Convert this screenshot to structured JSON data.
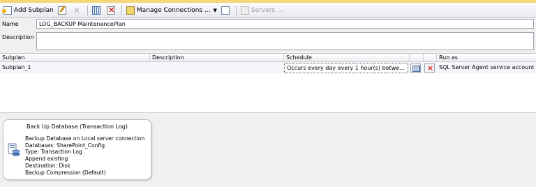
{
  "toolbar": {
    "add_subplan_label": "Add Subplan",
    "manage_connections_label": "Manage Connections ...",
    "servers_label": "Servers ..."
  },
  "form": {
    "name_label": "Name",
    "name_value": "LOG_BACKUP MaintenancePlan",
    "description_label": "Description",
    "description_value": ""
  },
  "grid": {
    "columns": [
      "Subplan",
      "Description",
      "Schedule",
      "Run as"
    ],
    "rows": [
      {
        "subplan": "Subplan_1",
        "description": "",
        "schedule": "Occurs every day every 1 hour(s) betwe...",
        "run_as": "SQL Server Agent service account"
      }
    ]
  },
  "task": {
    "title": "Back Up Database (Transaction Log)",
    "lines": [
      "Backup Database on Local server connection",
      "Databases: SharePoint_Config",
      "Type: Transaction Log",
      "Append existing",
      "Destination: Disk",
      "Backup Compression (Default)"
    ]
  },
  "colors": {
    "top_strip": "#f5d77a",
    "selected_row": "#f4f6f9",
    "delete_red": "#d02020"
  }
}
